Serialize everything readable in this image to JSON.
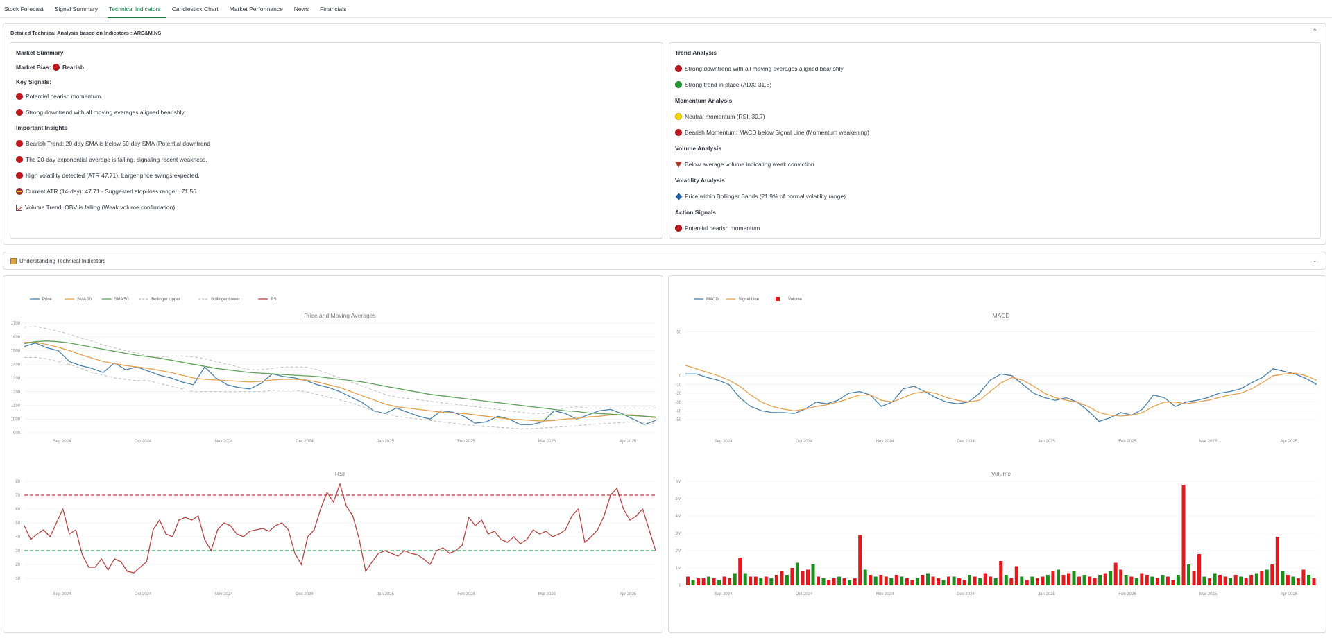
{
  "tabs": [
    "Stock Forecast",
    "Signal Summary",
    "Technical Indicators",
    "Candlestick Chart",
    "Market Performance",
    "News",
    "Financials"
  ],
  "active_tab": 2,
  "analysis": {
    "title": "Detailed Technical Analysis based on Indicators : ARE&M.NS",
    "left": {
      "market_summary": "Market Summary",
      "market_bias_label": "Market Bias:",
      "market_bias_value": "Bearish.",
      "key_signals": "Key Signals:",
      "signals": [
        "Potential bearish momentum.",
        "Strong downtrend with all moving averages aligned bearishly."
      ],
      "insights_header": "Important Insights",
      "insights": [
        "Bearish Trend: 20-day SMA is below 50-day SMA (Potential downtrend",
        "The 20-day exponential average is falling, signaling recent weakness.",
        "High volatility detected (ATR 47.71). Larger price swings expected.",
        "Current ATR (14-day): 47.71 - Suggested stop-loss range: ±71.56",
        "Volume Trend: OBV is falling (Weak volume confirmation)"
      ]
    },
    "right": {
      "trend_header": "Trend Analysis",
      "trend": [
        "Strong downtrend with all moving averages aligned bearishly",
        "Strong trend in place (ADX: 31.8)"
      ],
      "momentum_header": "Momentum Analysis",
      "momentum": [
        "Neutral momentum (RSI: 30.7)",
        "Bearish Momentum: MACD below Signal Line (Momentum weakening)"
      ],
      "volume_header": "Volume Analysis",
      "volume": [
        "Below average volume indicating weak conviction"
      ],
      "volatility_header": "Volatility Analysis",
      "volatility": [
        "Price within Bollinger Bands (21.9% of normal volatility range)"
      ],
      "action_header": "Action Signals",
      "action": [
        "Potential bearish momentum"
      ]
    }
  },
  "understanding": "Understanding Technical Indicators",
  "chart_data": [
    {
      "type": "line",
      "title": "Price and Moving Averages",
      "legend": [
        "Price",
        "SMA 20",
        "SMA 50",
        "Bollinger Upper",
        "Bollinger Lower",
        "RSI"
      ],
      "months": [
        "Sep 2024",
        "Oct 2024",
        "Nov 2024",
        "Dec 2024",
        "Jan 2025",
        "Feb 2025",
        "Mar 2025",
        "Apr 2025"
      ],
      "ylim": [
        900,
        1700
      ],
      "yticks": [
        900,
        1000,
        1100,
        1200,
        1300,
        1400,
        1500,
        1600,
        1700
      ],
      "series": [
        {
          "name": "Price",
          "color": "#4a7fa5",
          "values": [
            1530,
            1555,
            1520,
            1500,
            1420,
            1390,
            1370,
            1340,
            1410,
            1360,
            1380,
            1350,
            1320,
            1300,
            1270,
            1250,
            1380,
            1300,
            1250,
            1230,
            1220,
            1260,
            1330,
            1310,
            1300,
            1280,
            1250,
            1230,
            1200,
            1160,
            1120,
            1060,
            1040,
            1080,
            1050,
            1020,
            1000,
            1060,
            1050,
            1020,
            970,
            980,
            1020,
            1000,
            960,
            960,
            980,
            1060,
            1040,
            1000,
            1030,
            1060,
            1070,
            1040,
            1000,
            960,
            990
          ]
        },
        {
          "name": "SMA 20",
          "color": "#e0a050",
          "values": [
            1560,
            1560,
            1545,
            1525,
            1500,
            1470,
            1445,
            1420,
            1405,
            1390,
            1380,
            1370,
            1355,
            1340,
            1320,
            1300,
            1290,
            1285,
            1280,
            1275,
            1270,
            1275,
            1285,
            1290,
            1290,
            1285,
            1270,
            1250,
            1230,
            1200,
            1170,
            1140,
            1110,
            1090,
            1080,
            1070,
            1060,
            1050,
            1045,
            1040,
            1030,
            1020,
            1010,
            1000,
            995,
            990,
            985,
            990,
            1000,
            1005,
            1015,
            1020,
            1030,
            1030,
            1030,
            1020,
            1010
          ]
        },
        {
          "name": "SMA 50",
          "color": "#5fa05a",
          "values": [
            1550,
            1565,
            1570,
            1565,
            1555,
            1540,
            1525,
            1510,
            1495,
            1480,
            1465,
            1455,
            1445,
            1430,
            1415,
            1400,
            1385,
            1370,
            1360,
            1350,
            1340,
            1335,
            1330,
            1325,
            1320,
            1315,
            1310,
            1300,
            1290,
            1280,
            1270,
            1255,
            1240,
            1225,
            1210,
            1195,
            1180,
            1170,
            1160,
            1150,
            1140,
            1130,
            1120,
            1110,
            1100,
            1090,
            1080,
            1070,
            1060,
            1055,
            1045,
            1040,
            1035,
            1030,
            1025,
            1020,
            1015
          ]
        },
        {
          "name": "Bollinger Upper",
          "color": "#bbbbbb",
          "dash": true,
          "values": [
            1670,
            1675,
            1660,
            1640,
            1620,
            1590,
            1570,
            1540,
            1520,
            1500,
            1480,
            1460,
            1450,
            1460,
            1460,
            1455,
            1440,
            1420,
            1400,
            1380,
            1360,
            1360,
            1370,
            1380,
            1380,
            1380,
            1360,
            1330,
            1300,
            1270,
            1240,
            1210,
            1180,
            1160,
            1150,
            1140,
            1130,
            1120,
            1110,
            1100,
            1090,
            1080,
            1070,
            1060,
            1050,
            1040,
            1040,
            1060,
            1080,
            1090,
            1080,
            1080,
            1080,
            1080,
            1080,
            1080,
            1080
          ]
        },
        {
          "name": "Bollinger Lower",
          "color": "#bbbbbb",
          "dash": true,
          "values": [
            1450,
            1450,
            1440,
            1420,
            1400,
            1370,
            1340,
            1320,
            1300,
            1290,
            1280,
            1280,
            1260,
            1240,
            1220,
            1200,
            1200,
            1200,
            1200,
            1200,
            1200,
            1200,
            1210,
            1210,
            1210,
            1200,
            1180,
            1160,
            1140,
            1120,
            1090,
            1060,
            1040,
            1020,
            1010,
            1000,
            990,
            980,
            970,
            960,
            950,
            945,
            940,
            935,
            930,
            930,
            935,
            940,
            945,
            950,
            960,
            965,
            970,
            975,
            980,
            975,
            970
          ]
        }
      ]
    },
    {
      "type": "line",
      "title": "RSI",
      "ylim": [
        5,
        80
      ],
      "yticks": [
        10,
        20,
        30,
        40,
        50,
        60,
        70,
        80
      ],
      "months": [
        "Sep 2024",
        "Oct 2024",
        "Nov 2024",
        "Dec 2024",
        "Jan 2025",
        "Feb 2025",
        "Mar 2025",
        "Apr 2025"
      ],
      "thresholds": [
        70,
        30
      ],
      "series": [
        {
          "name": "RSI",
          "color": "#b04545",
          "values": [
            48,
            38,
            42,
            45,
            40,
            50,
            60,
            42,
            45,
            27,
            18,
            18,
            24,
            16,
            24,
            22,
            15,
            14,
            18,
            22,
            45,
            52,
            42,
            40,
            52,
            54,
            52,
            55,
            38,
            30,
            45,
            50,
            48,
            42,
            40,
            44,
            45,
            46,
            44,
            48,
            50,
            45,
            28,
            20,
            40,
            45,
            60,
            72,
            65,
            78,
            62,
            55,
            38,
            15,
            22,
            28,
            30,
            28,
            26,
            30,
            28,
            27,
            24,
            20,
            30,
            32,
            28,
            30,
            34,
            54,
            48,
            52,
            42,
            44,
            38,
            36,
            40,
            35,
            38,
            45,
            42,
            44,
            40,
            42,
            45,
            55,
            60,
            36,
            40,
            45,
            55,
            70,
            75,
            60,
            52,
            55,
            60,
            45,
            30
          ]
        }
      ]
    },
    {
      "type": "line",
      "title": "MACD",
      "legend": [
        "MACD",
        "Signal Line",
        "Volume"
      ],
      "ylim": [
        -65,
        60
      ],
      "yticks": [
        50,
        0,
        -10,
        -20,
        -30,
        -40,
        -50
      ],
      "ytick_labels": [
        "50",
        "0",
        "-10",
        "-20",
        "-30",
        "-40",
        "-50"
      ],
      "months": [
        "Sep 2024",
        "Oct 2024",
        "Nov 2024",
        "Dec 2024",
        "Jan 2025",
        "Feb 2025",
        "Mar 2025",
        "Apr 2025"
      ],
      "series": [
        {
          "name": "MACD",
          "color": "#4a7fa5",
          "values": [
            2,
            2,
            -2,
            -5,
            -10,
            -25,
            -35,
            -40,
            -42,
            -42,
            -43,
            -38,
            -30,
            -32,
            -28,
            -20,
            -18,
            -22,
            -35,
            -30,
            -15,
            -12,
            -18,
            -25,
            -30,
            -32,
            -30,
            -20,
            -5,
            2,
            0,
            -10,
            -20,
            -25,
            -28,
            -25,
            -30,
            -40,
            -52,
            -48,
            -42,
            -45,
            -38,
            -22,
            -25,
            -35,
            -30,
            -28,
            -25,
            -20,
            -18,
            -15,
            -8,
            -2,
            8,
            5,
            2,
            -3,
            -10
          ]
        },
        {
          "name": "Signal Line",
          "color": "#e0a050",
          "values": [
            12,
            8,
            4,
            0,
            -5,
            -12,
            -22,
            -30,
            -35,
            -38,
            -40,
            -38,
            -35,
            -33,
            -30,
            -26,
            -22,
            -22,
            -28,
            -30,
            -25,
            -20,
            -18,
            -20,
            -25,
            -28,
            -30,
            -28,
            -18,
            -8,
            -2,
            -5,
            -12,
            -20,
            -25,
            -28,
            -30,
            -35,
            -42,
            -45,
            -46,
            -45,
            -42,
            -35,
            -30,
            -30,
            -32,
            -30,
            -28,
            -25,
            -22,
            -20,
            -15,
            -8,
            0,
            2,
            3,
            0,
            -5
          ]
        }
      ]
    },
    {
      "type": "bar",
      "title": "Volume",
      "ylim": [
        0,
        6000000
      ],
      "yticks": [
        0,
        1000000,
        2000000,
        3000000,
        4000000,
        5000000,
        6000000
      ],
      "ytick_labels": [
        "0",
        "1M",
        "2M",
        "3M",
        "4M",
        "5M",
        "6M"
      ],
      "months": [
        "Sep 2024",
        "Oct 2024",
        "Nov 2024",
        "Dec 2024",
        "Jan 2025",
        "Feb 2025",
        "Mar 2025",
        "Apr 2025"
      ],
      "values": [
        0.5,
        0.3,
        0.4,
        0.4,
        0.5,
        0.4,
        0.3,
        0.5,
        0.4,
        0.7,
        1.6,
        0.7,
        0.5,
        0.5,
        0.4,
        0.5,
        0.4,
        0.6,
        0.8,
        0.6,
        1.0,
        1.3,
        0.8,
        0.9,
        1.2,
        0.5,
        0.4,
        0.3,
        0.4,
        0.5,
        0.4,
        0.3,
        0.4,
        2.9,
        0.9,
        0.6,
        0.5,
        0.6,
        0.5,
        0.4,
        0.6,
        0.5,
        0.4,
        0.3,
        0.4,
        0.6,
        0.7,
        0.5,
        0.4,
        0.3,
        0.5,
        0.5,
        0.4,
        0.3,
        0.6,
        0.5,
        0.4,
        0.7,
        0.5,
        0.4,
        1.4,
        0.6,
        0.4,
        1.1,
        0.5,
        0.3,
        0.5,
        0.4,
        0.5,
        0.6,
        0.8,
        0.9,
        0.6,
        0.7,
        0.8,
        0.5,
        0.6,
        0.5,
        0.4,
        0.6,
        0.7,
        0.8,
        1.3,
        0.9,
        0.6,
        0.5,
        0.4,
        0.7,
        0.6,
        0.5,
        0.4,
        0.6,
        0.5,
        0.3,
        0.6,
        5.8,
        1.2,
        0.8,
        1.8,
        0.5,
        0.4,
        0.7,
        0.6,
        0.5,
        0.4,
        0.6,
        0.5,
        0.4,
        0.6,
        0.7,
        0.8,
        0.9,
        1.2,
        2.8,
        0.8,
        0.6,
        0.5,
        0.4,
        0.9,
        0.6,
        0.4
      ],
      "colors_pattern": "mixed"
    }
  ]
}
